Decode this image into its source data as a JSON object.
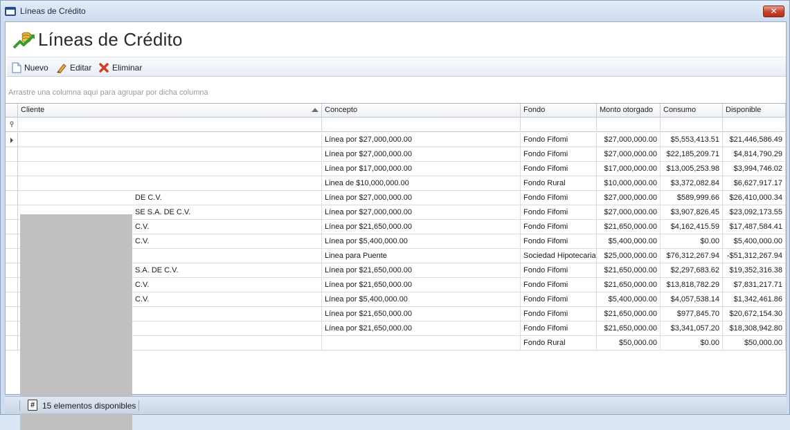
{
  "window": {
    "title": "Líneas de Crédito",
    "close_label": "✕"
  },
  "header": {
    "title": "Líneas de Crédito"
  },
  "toolbar": {
    "new_label": "Nuevo",
    "edit_label": "Editar",
    "delete_label": "Eliminar"
  },
  "group_panel": {
    "hint": "Arrastre una columna aquí para agrupar por dicha columna"
  },
  "grid": {
    "columns": [
      "Cliente",
      "Concepto",
      "Fondo",
      "Monto otorgado",
      "Consumo",
      "Disponible"
    ],
    "rows": [
      {
        "cliente": "",
        "concepto": "Línea por $27,000,000.00",
        "fondo": "Fondo Fifomi",
        "monto": "$27,000,000.00",
        "consumo": "$5,553,413.51",
        "disponible": "$21,446,586.49"
      },
      {
        "cliente": "",
        "concepto": "Línea por $27,000,000.00",
        "fondo": "Fondo Fifomi",
        "monto": "$27,000,000.00",
        "consumo": "$22,185,209.71",
        "disponible": "$4,814,790.29"
      },
      {
        "cliente": "",
        "concepto": "Línea por $17,000,000.00",
        "fondo": "Fondo Fifomi",
        "monto": "$17,000,000.00",
        "consumo": "$13,005,253.98",
        "disponible": "$3,994,746.02"
      },
      {
        "cliente": "",
        "concepto": "Linea de $10,000,000.00",
        "fondo": "Fondo Rural",
        "monto": "$10,000,000.00",
        "consumo": "$3,372,082.84",
        "disponible": "$6,627,917.17"
      },
      {
        "cliente": "DE C.V.",
        "concepto": "Línea por $27,000,000.00",
        "fondo": "Fondo Fifomi",
        "monto": "$27,000,000.00",
        "consumo": "$589,999.66",
        "disponible": "$26,410,000.34"
      },
      {
        "cliente": "SE S.A. DE C.V.",
        "concepto": "Línea por $27,000,000.00",
        "fondo": "Fondo Fifomi",
        "monto": "$27,000,000.00",
        "consumo": "$3,907,826.45",
        "disponible": "$23,092,173.55"
      },
      {
        "cliente": "C.V.",
        "concepto": "Línea por $21,650,000.00",
        "fondo": "Fondo Fifomi",
        "monto": "$21,650,000.00",
        "consumo": "$4,162,415.59",
        "disponible": "$17,487,584.41"
      },
      {
        "cliente": "C.V.",
        "concepto": "Línea por $5,400,000.00",
        "fondo": "Fondo Fifomi",
        "monto": "$5,400,000.00",
        "consumo": "$0.00",
        "disponible": "$5,400,000.00"
      },
      {
        "cliente": "",
        "concepto": "Linea para Puente",
        "fondo": "Sociedad Hipotecaria",
        "monto": "$25,000,000.00",
        "consumo": "$76,312,267.94",
        "disponible": "-$51,312,267.94"
      },
      {
        "cliente": "S.A. DE C.V.",
        "concepto": "Línea por $21,650,000.00",
        "fondo": "Fondo Fifomi",
        "monto": "$21,650,000.00",
        "consumo": "$2,297,683.62",
        "disponible": "$19,352,316.38"
      },
      {
        "cliente": "C.V.",
        "concepto": "Línea por $21,650,000.00",
        "fondo": "Fondo Fifomi",
        "monto": "$21,650,000.00",
        "consumo": "$13,818,782.29",
        "disponible": "$7,831,217.71"
      },
      {
        "cliente": "C.V.",
        "concepto": "Línea por $5,400,000.00",
        "fondo": "Fondo Fifomi",
        "monto": "$5,400,000.00",
        "consumo": "$4,057,538.14",
        "disponible": "$1,342,461.86"
      },
      {
        "cliente": "",
        "concepto": "Línea por $21,650,000.00",
        "fondo": "Fondo Fifomi",
        "monto": "$21,650,000.00",
        "consumo": "$977,845.70",
        "disponible": "$20,672,154.30"
      },
      {
        "cliente": "",
        "concepto": "Línea por $21,650,000.00",
        "fondo": "Fondo Fifomi",
        "monto": "$21,650,000.00",
        "consumo": "$3,341,057.20",
        "disponible": "$18,308,942.80"
      },
      {
        "cliente": "",
        "concepto": "",
        "fondo": "Fondo Rural",
        "monto": "$50,000.00",
        "consumo": "$0.00",
        "disponible": "$50,000.00"
      }
    ]
  },
  "status": {
    "icon_glyph": "#",
    "text": "15 elementos disponibles"
  },
  "icons": {
    "window": "window-app-icon",
    "header": "credit-chart-icon",
    "new": "new-document-icon",
    "edit": "pencil-icon",
    "delete": "red-x-icon",
    "filter": "filter-pin-icon",
    "status": "hash-icon"
  },
  "colors": {
    "accent": "#1f4f9a",
    "close": "#c8402b",
    "delete": "#d93a22"
  }
}
